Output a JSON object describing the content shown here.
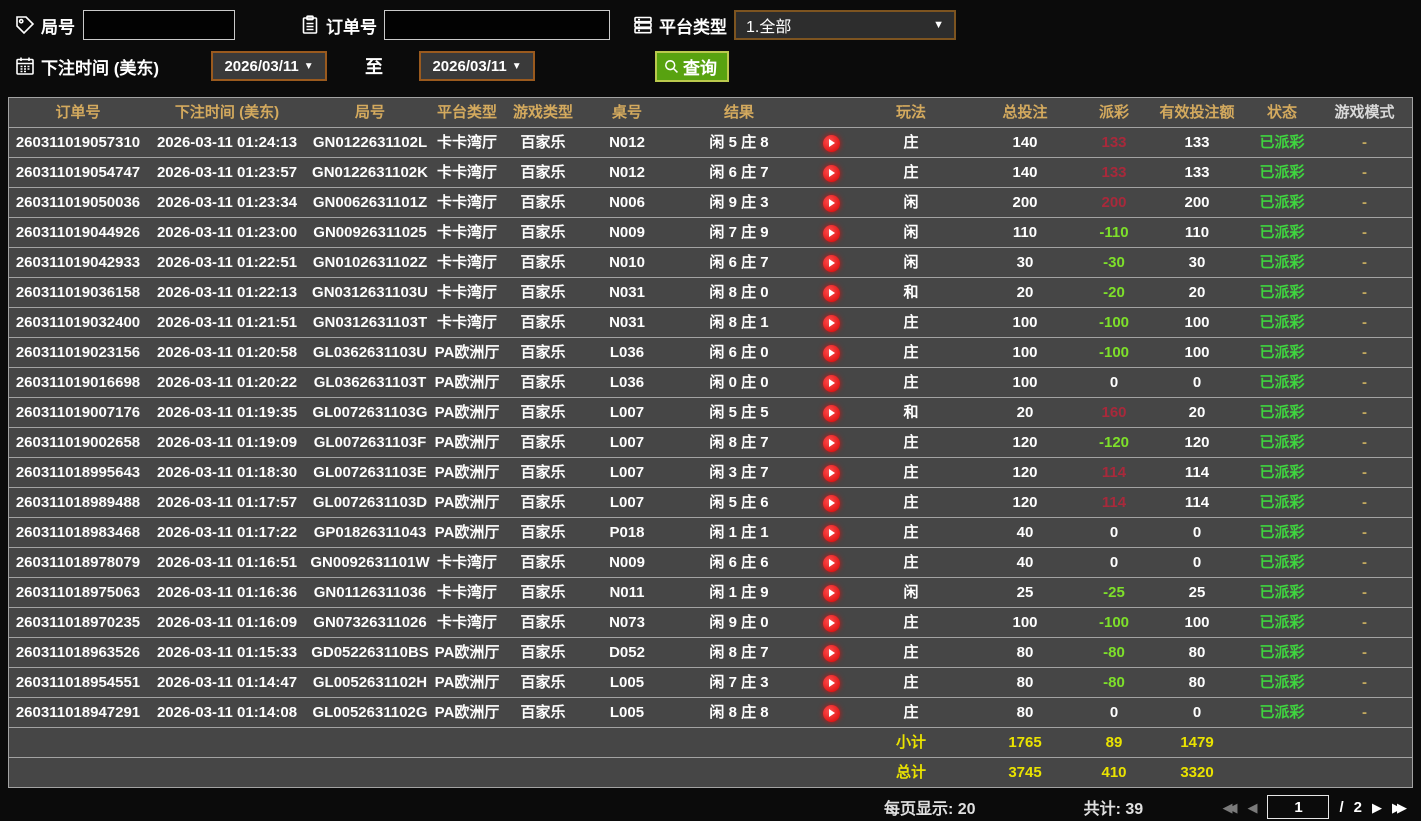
{
  "filters": {
    "game_no": {
      "label": "局号",
      "value": ""
    },
    "order_no": {
      "label": "订单号",
      "value": ""
    },
    "platform": {
      "label": "平台类型",
      "value": "1.全部"
    },
    "bet_time": {
      "label": "下注时间 (美东)",
      "from": "2026/03/11",
      "to_label": "至",
      "to": "2026/03/11"
    },
    "search": {
      "label": "查询"
    }
  },
  "table": {
    "columns": [
      "订单号",
      "下注时间 (美东)",
      "局号",
      "平台类型",
      "游戏类型",
      "桌号",
      "结果",
      "玩法",
      "总投注",
      "派彩",
      "有效投注额",
      "状态",
      "游戏模式"
    ],
    "rows": [
      {
        "order_id": "260311019057310",
        "bet_time": "2026-03-11 01:24:13",
        "game_no": "GN0122631102L",
        "platform": "卡卡湾厅",
        "game_type": "百家乐",
        "table_no": "N012",
        "result": "闲 5 庄 8",
        "play": "庄",
        "total_bet": "140",
        "payout": "133",
        "payout_tone": "pos",
        "valid_bet": "133",
        "status": "已派彩",
        "mode": "-"
      },
      {
        "order_id": "260311019054747",
        "bet_time": "2026-03-11 01:23:57",
        "game_no": "GN0122631102K",
        "platform": "卡卡湾厅",
        "game_type": "百家乐",
        "table_no": "N012",
        "result": "闲 6 庄 7",
        "play": "庄",
        "total_bet": "140",
        "payout": "133",
        "payout_tone": "pos",
        "valid_bet": "133",
        "status": "已派彩",
        "mode": "-"
      },
      {
        "order_id": "260311019050036",
        "bet_time": "2026-03-11 01:23:34",
        "game_no": "GN0062631101Z",
        "platform": "卡卡湾厅",
        "game_type": "百家乐",
        "table_no": "N006",
        "result": "闲 9 庄 3",
        "play": "闲",
        "total_bet": "200",
        "payout": "200",
        "payout_tone": "pos",
        "valid_bet": "200",
        "status": "已派彩",
        "mode": "-"
      },
      {
        "order_id": "260311019044926",
        "bet_time": "2026-03-11 01:23:00",
        "game_no": "GN00926311025",
        "platform": "卡卡湾厅",
        "game_type": "百家乐",
        "table_no": "N009",
        "result": "闲 7 庄 9",
        "play": "闲",
        "total_bet": "110",
        "payout": "-110",
        "payout_tone": "neg",
        "valid_bet": "110",
        "status": "已派彩",
        "mode": "-"
      },
      {
        "order_id": "260311019042933",
        "bet_time": "2026-03-11 01:22:51",
        "game_no": "GN0102631102Z",
        "platform": "卡卡湾厅",
        "game_type": "百家乐",
        "table_no": "N010",
        "result": "闲 6 庄 7",
        "play": "闲",
        "total_bet": "30",
        "payout": "-30",
        "payout_tone": "neg",
        "valid_bet": "30",
        "status": "已派彩",
        "mode": "-"
      },
      {
        "order_id": "260311019036158",
        "bet_time": "2026-03-11 01:22:13",
        "game_no": "GN0312631103U",
        "platform": "卡卡湾厅",
        "game_type": "百家乐",
        "table_no": "N031",
        "result": "闲 8 庄 0",
        "play": "和",
        "total_bet": "20",
        "payout": "-20",
        "payout_tone": "neg",
        "valid_bet": "20",
        "status": "已派彩",
        "mode": "-"
      },
      {
        "order_id": "260311019032400",
        "bet_time": "2026-03-11 01:21:51",
        "game_no": "GN0312631103T",
        "platform": "卡卡湾厅",
        "game_type": "百家乐",
        "table_no": "N031",
        "result": "闲 8 庄 1",
        "play": "庄",
        "total_bet": "100",
        "payout": "-100",
        "payout_tone": "neg",
        "valid_bet": "100",
        "status": "已派彩",
        "mode": "-"
      },
      {
        "order_id": "260311019023156",
        "bet_time": "2026-03-11 01:20:58",
        "game_no": "GL0362631103U",
        "platform": "PA欧洲厅",
        "game_type": "百家乐",
        "table_no": "L036",
        "result": "闲 6 庄 0",
        "play": "庄",
        "total_bet": "100",
        "payout": "-100",
        "payout_tone": "neg",
        "valid_bet": "100",
        "status": "已派彩",
        "mode": "-"
      },
      {
        "order_id": "260311019016698",
        "bet_time": "2026-03-11 01:20:22",
        "game_no": "GL0362631103T",
        "platform": "PA欧洲厅",
        "game_type": "百家乐",
        "table_no": "L036",
        "result": "闲 0 庄 0",
        "play": "庄",
        "total_bet": "100",
        "payout": "0",
        "payout_tone": "",
        "valid_bet": "0",
        "status": "已派彩",
        "mode": "-"
      },
      {
        "order_id": "260311019007176",
        "bet_time": "2026-03-11 01:19:35",
        "game_no": "GL0072631103G",
        "platform": "PA欧洲厅",
        "game_type": "百家乐",
        "table_no": "L007",
        "result": "闲 5 庄 5",
        "play": "和",
        "total_bet": "20",
        "payout": "160",
        "payout_tone": "pos",
        "valid_bet": "20",
        "status": "已派彩",
        "mode": "-"
      },
      {
        "order_id": "260311019002658",
        "bet_time": "2026-03-11 01:19:09",
        "game_no": "GL0072631103F",
        "platform": "PA欧洲厅",
        "game_type": "百家乐",
        "table_no": "L007",
        "result": "闲 8 庄 7",
        "play": "庄",
        "total_bet": "120",
        "payout": "-120",
        "payout_tone": "neg",
        "valid_bet": "120",
        "status": "已派彩",
        "mode": "-"
      },
      {
        "order_id": "260311018995643",
        "bet_time": "2026-03-11 01:18:30",
        "game_no": "GL0072631103E",
        "platform": "PA欧洲厅",
        "game_type": "百家乐",
        "table_no": "L007",
        "result": "闲 3 庄 7",
        "play": "庄",
        "total_bet": "120",
        "payout": "114",
        "payout_tone": "pos",
        "valid_bet": "114",
        "status": "已派彩",
        "mode": "-"
      },
      {
        "order_id": "260311018989488",
        "bet_time": "2026-03-11 01:17:57",
        "game_no": "GL0072631103D",
        "platform": "PA欧洲厅",
        "game_type": "百家乐",
        "table_no": "L007",
        "result": "闲 5 庄 6",
        "play": "庄",
        "total_bet": "120",
        "payout": "114",
        "payout_tone": "pos",
        "valid_bet": "114",
        "status": "已派彩",
        "mode": "-"
      },
      {
        "order_id": "260311018983468",
        "bet_time": "2026-03-11 01:17:22",
        "game_no": "GP01826311043",
        "platform": "PA欧洲厅",
        "game_type": "百家乐",
        "table_no": "P018",
        "result": "闲 1 庄 1",
        "play": "庄",
        "total_bet": "40",
        "payout": "0",
        "payout_tone": "",
        "valid_bet": "0",
        "status": "已派彩",
        "mode": "-"
      },
      {
        "order_id": "260311018978079",
        "bet_time": "2026-03-11 01:16:51",
        "game_no": "GN0092631101W",
        "platform": "卡卡湾厅",
        "game_type": "百家乐",
        "table_no": "N009",
        "result": "闲 6 庄 6",
        "play": "庄",
        "total_bet": "40",
        "payout": "0",
        "payout_tone": "",
        "valid_bet": "0",
        "status": "已派彩",
        "mode": "-"
      },
      {
        "order_id": "260311018975063",
        "bet_time": "2026-03-11 01:16:36",
        "game_no": "GN01126311036",
        "platform": "卡卡湾厅",
        "game_type": "百家乐",
        "table_no": "N011",
        "result": "闲 1 庄 9",
        "play": "闲",
        "total_bet": "25",
        "payout": "-25",
        "payout_tone": "neg",
        "valid_bet": "25",
        "status": "已派彩",
        "mode": "-"
      },
      {
        "order_id": "260311018970235",
        "bet_time": "2026-03-11 01:16:09",
        "game_no": "GN07326311026",
        "platform": "卡卡湾厅",
        "game_type": "百家乐",
        "table_no": "N073",
        "result": "闲 9 庄 0",
        "play": "庄",
        "total_bet": "100",
        "payout": "-100",
        "payout_tone": "neg",
        "valid_bet": "100",
        "status": "已派彩",
        "mode": "-"
      },
      {
        "order_id": "260311018963526",
        "bet_time": "2026-03-11 01:15:33",
        "game_no": "GD052263110BS",
        "platform": "PA欧洲厅",
        "game_type": "百家乐",
        "table_no": "D052",
        "result": "闲 8 庄 7",
        "play": "庄",
        "total_bet": "80",
        "payout": "-80",
        "payout_tone": "neg",
        "valid_bet": "80",
        "status": "已派彩",
        "mode": "-"
      },
      {
        "order_id": "260311018954551",
        "bet_time": "2026-03-11 01:14:47",
        "game_no": "GL0052631102H",
        "platform": "PA欧洲厅",
        "game_type": "百家乐",
        "table_no": "L005",
        "result": "闲 7 庄 3",
        "play": "庄",
        "total_bet": "80",
        "payout": "-80",
        "payout_tone": "neg",
        "valid_bet": "80",
        "status": "已派彩",
        "mode": "-"
      },
      {
        "order_id": "260311018947291",
        "bet_time": "2026-03-11 01:14:08",
        "game_no": "GL0052631102G",
        "platform": "PA欧洲厅",
        "game_type": "百家乐",
        "table_no": "L005",
        "result": "闲 8 庄 8",
        "play": "庄",
        "total_bet": "80",
        "payout": "0",
        "payout_tone": "",
        "valid_bet": "0",
        "status": "已派彩",
        "mode": "-"
      }
    ]
  },
  "summary": {
    "subtotal": {
      "label": "小计",
      "total_bet": "1765",
      "payout": "89",
      "valid_bet": "1479"
    },
    "total": {
      "label": "总计",
      "total_bet": "3745",
      "payout": "410",
      "valid_bet": "3320"
    }
  },
  "footer": {
    "page_size_label": "每页显示: 20",
    "total_count_label": "共计: 39",
    "current_page": "1",
    "page_divider": "/",
    "total_pages": "2"
  },
  "colors": {
    "header_gold": "#d4aa5e",
    "payout_positive_red": "#a8293b",
    "payout_negative_green": "#7ee02a",
    "status_green": "#3fd43f",
    "summary_yellow": "#eae300",
    "search_button_green": "#58a210",
    "datebox_border_brown": "#9a5a1e"
  }
}
